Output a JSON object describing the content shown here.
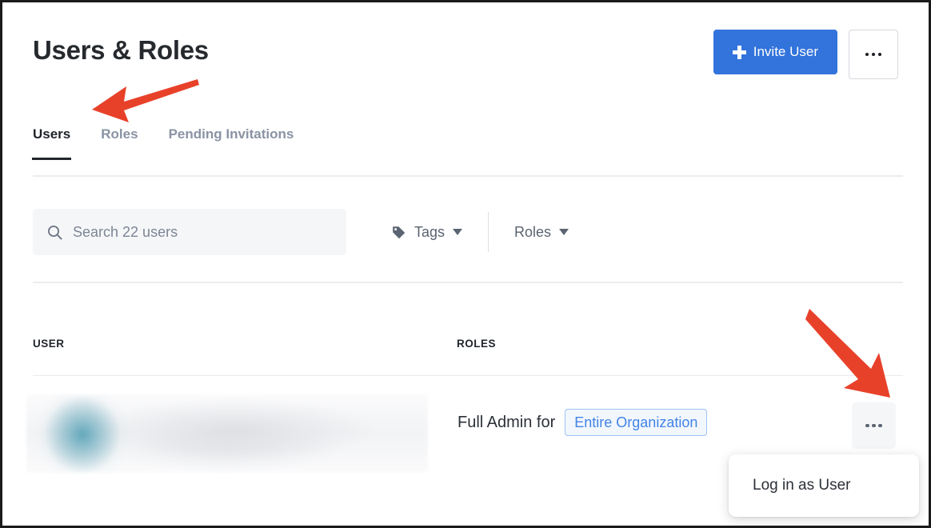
{
  "header": {
    "title": "Users & Roles",
    "invite_button": "Invite User",
    "invite_icon": "plus-icon",
    "more_button_icon": "ellipsis-icon"
  },
  "tabs": [
    {
      "label": "Users",
      "active": true
    },
    {
      "label": "Roles",
      "active": false
    },
    {
      "label": "Pending Invitations",
      "active": false
    }
  ],
  "filters": {
    "search_placeholder": "Search 22 users",
    "search_value": "",
    "search_icon": "search-icon",
    "tags": {
      "label": "Tags",
      "icon": "tag-icon"
    },
    "roles": {
      "label": "Roles"
    }
  },
  "table": {
    "columns": [
      "USER",
      "ROLES"
    ],
    "rows": [
      {
        "user": "",
        "user_redacted": true,
        "role_text": "Full Admin for",
        "role_scope": "Entire Organization",
        "row_menu_icon": "ellipsis-icon"
      }
    ]
  },
  "popup_menu": {
    "items": [
      "Log in as User"
    ]
  },
  "annotations": [
    {
      "name": "arrow-pointing-to-users-tab",
      "color": "#e8412a"
    },
    {
      "name": "arrow-pointing-to-row-menu",
      "color": "#e8412a"
    }
  ],
  "colors": {
    "primary_blue": "#3273dc",
    "pill_blue": "#4283e4",
    "annotation_red": "#e8412a",
    "text_dark": "#22262c",
    "text_muted": "#5b6472"
  }
}
